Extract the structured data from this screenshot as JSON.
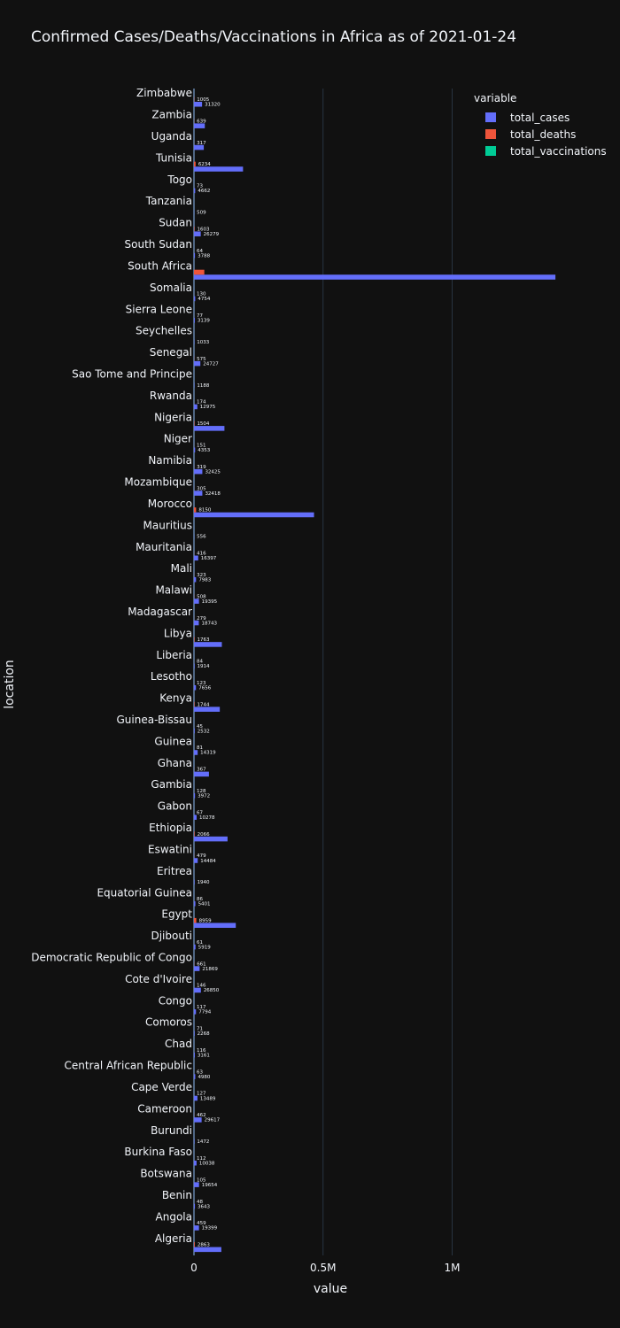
{
  "chart_data": {
    "type": "bar",
    "orientation": "horizontal",
    "title": "Confirmed Cases/Deaths/Vaccinations in Africa as of 2021-01-24",
    "xlabel": "value",
    "ylabel": "location",
    "legend_title": "variable",
    "legend_position": "top-right",
    "x_ticks": [
      {
        "value": 0,
        "label": "0"
      },
      {
        "value": 500000,
        "label": "0.5M"
      },
      {
        "value": 1000000,
        "label": "1M"
      }
    ],
    "xlim": [
      0,
      1410000
    ],
    "grid": true,
    "categories": [
      "Zimbabwe",
      "Zambia",
      "Uganda",
      "Tunisia",
      "Togo",
      "Tanzania",
      "Sudan",
      "South Sudan",
      "South Africa",
      "Somalia",
      "Sierra Leone",
      "Seychelles",
      "Senegal",
      "Sao Tome and Principe",
      "Rwanda",
      "Nigeria",
      "Niger",
      "Namibia",
      "Mozambique",
      "Morocco",
      "Mauritius",
      "Mauritania",
      "Mali",
      "Malawi",
      "Madagascar",
      "Libya",
      "Liberia",
      "Lesotho",
      "Kenya",
      "Guinea-Bissau",
      "Guinea",
      "Ghana",
      "Gambia",
      "Gabon",
      "Ethiopia",
      "Eswatini",
      "Eritrea",
      "Equatorial Guinea",
      "Egypt",
      "Djibouti",
      "Democratic Republic of Congo",
      "Cote d'Ivoire",
      "Congo",
      "Comoros",
      "Chad",
      "Central African Republic",
      "Cape Verde",
      "Cameroon",
      "Burundi",
      "Burkina Faso",
      "Botswana",
      "Benin",
      "Angola",
      "Algeria"
    ],
    "series": [
      {
        "name": "total_cases",
        "color": "#636efa",
        "values": [
          31320,
          42000,
          38000,
          190000,
          4662,
          509,
          26279,
          3788,
          1400000,
          4754,
          3139,
          1033,
          24727,
          1188,
          12975,
          118000,
          4353,
          32425,
          32418,
          465000,
          556,
          16397,
          7983,
          19395,
          18743,
          108000,
          1914,
          7656,
          100000,
          2532,
          14319,
          58000,
          3972,
          10278,
          130000,
          14484,
          1940,
          5401,
          162000,
          5919,
          21869,
          26850,
          7794,
          2268,
          3161,
          4980,
          13489,
          29617,
          1472,
          10038,
          19654,
          3643,
          19399,
          106000
        ],
        "labels": [
          "31320",
          "",
          "",
          "",
          "4662",
          "509",
          "26279",
          "3788",
          "",
          "4754",
          "3139",
          "1033",
          "24727",
          "1188",
          "12975",
          "",
          "4353",
          "32425",
          "32418",
          "",
          "556",
          "16397",
          "7983",
          "19395",
          "18743",
          "",
          "1914",
          "7656",
          "",
          "2532",
          "14319",
          "",
          "3972",
          "10278",
          "",
          "14484",
          "1940",
          "5401",
          "",
          "5919",
          "21869",
          "26850",
          "7794",
          "2268",
          "3161",
          "4980",
          "13489",
          "29617",
          "1472",
          "10038",
          "19654",
          "3643",
          "19399",
          ""
        ]
      },
      {
        "name": "total_deaths",
        "color": "#ef553b",
        "values": [
          1005,
          639,
          317,
          6234,
          73,
          0,
          1603,
          64,
          40000,
          130,
          77,
          0,
          575,
          0,
          174,
          1504,
          151,
          319,
          305,
          8150,
          0,
          416,
          323,
          508,
          279,
          1763,
          84,
          123,
          1744,
          45,
          81,
          367,
          128,
          67,
          2066,
          479,
          0,
          86,
          8959,
          61,
          661,
          146,
          117,
          71,
          116,
          63,
          127,
          462,
          0,
          112,
          105,
          48,
          459,
          2863
        ],
        "labels": [
          "1005",
          "639",
          "317",
          "6234",
          "73",
          "",
          "1603",
          "64",
          "",
          "130",
          "77",
          "",
          "575",
          "",
          "174",
          "1504",
          "151",
          "319",
          "305",
          "8150",
          "",
          "416",
          "323",
          "508",
          "279",
          "1763",
          "84",
          "123",
          "1744",
          "45",
          "81",
          "367",
          "128",
          "67",
          "2066",
          "479",
          "",
          "86",
          "8959",
          "61",
          "661",
          "146",
          "117",
          "71",
          "116",
          "63",
          "127",
          "462",
          "",
          "112",
          "105",
          "48",
          "459",
          "2863"
        ]
      },
      {
        "name": "total_vaccinations",
        "color": "#00cc96",
        "values": [
          0,
          0,
          0,
          0,
          0,
          0,
          0,
          0,
          0,
          0,
          0,
          0,
          0,
          0,
          0,
          0,
          0,
          0,
          0,
          0,
          0,
          0,
          0,
          0,
          0,
          0,
          0,
          0,
          0,
          0,
          0,
          0,
          0,
          0,
          0,
          0,
          0,
          0,
          0,
          0,
          0,
          0,
          0,
          0,
          0,
          0,
          0,
          0,
          0,
          0,
          0,
          0,
          0,
          0
        ],
        "labels": []
      }
    ]
  }
}
